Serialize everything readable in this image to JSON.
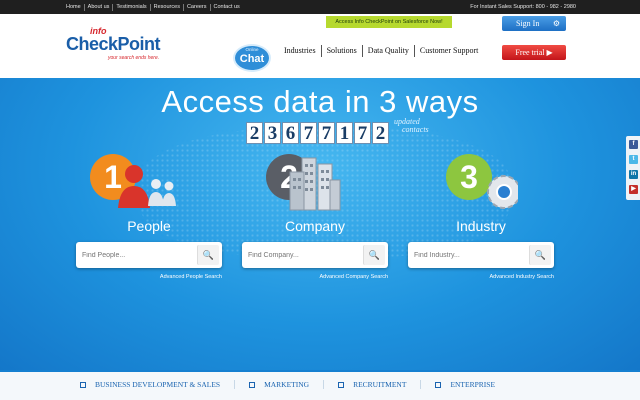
{
  "topbar": {
    "links": [
      "Home",
      "About us",
      "Testimonials",
      "Resources",
      "Careers",
      "Contact us"
    ],
    "sales_support": "For Instant Sales Support: 800 - 982 - 2980"
  },
  "header": {
    "logo_info": "info",
    "logo_main": "CheckPoint",
    "logo_tagline": "your search ends here.",
    "salesforce_banner": "Access Info CheckPoint on Salesforce Now!",
    "signin_label": "Sign In",
    "chat_live": "Online",
    "chat_label": "Chat",
    "nav": [
      "Industries",
      "Solutions",
      "Data Quality",
      "Customer Support"
    ],
    "free_trial_label": "Free trial ▶"
  },
  "hero": {
    "headline": "Access data in 3 ways",
    "counter_digits": [
      "2",
      "3",
      "6",
      "7",
      "7",
      "1",
      "7",
      "2"
    ],
    "updated_line1": "updated",
    "updated_line2": "contacts",
    "categories": [
      {
        "number": "1",
        "title": "People",
        "placeholder": "Find People...",
        "advanced": "Advanced People Search",
        "color": "#f28c1e"
      },
      {
        "number": "2",
        "title": "Company",
        "placeholder": "Find Company...",
        "advanced": "Advanced Company Search",
        "color": "#5a5e66"
      },
      {
        "number": "3",
        "title": "Industry",
        "placeholder": "Find Industry...",
        "advanced": "Advanced Industry Search",
        "color": "#8dc63f"
      }
    ]
  },
  "social": [
    "facebook-icon",
    "twitter-icon",
    "linkedin-icon",
    "youtube-icon"
  ],
  "bottom_nav": [
    "BUSINESS DEVELOPMENT & SALES",
    "MARKETING",
    "RECRUITMENT",
    "ENTERPRISE"
  ],
  "colors": {
    "brand_blue": "#1a5ea8",
    "accent_red": "#d6262c",
    "hero_blue": "#1e93de"
  }
}
